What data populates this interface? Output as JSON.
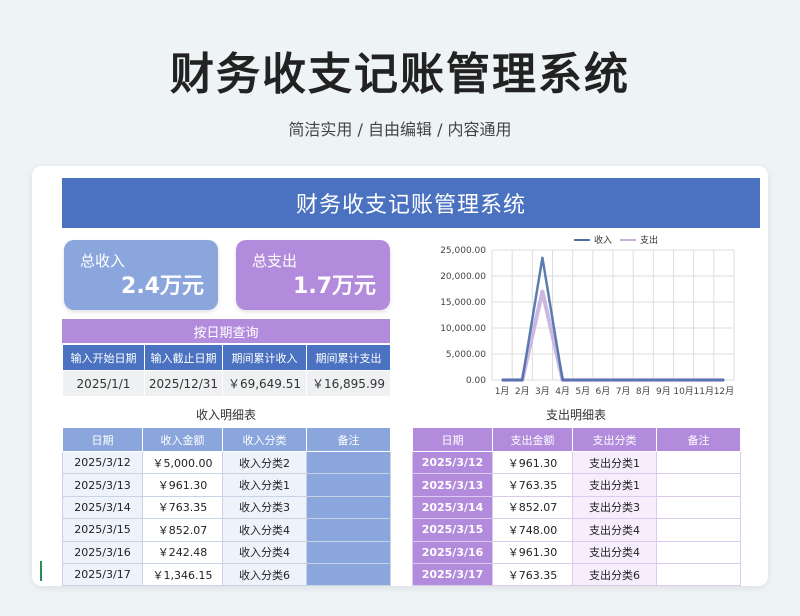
{
  "hero": {
    "title": "财务收支记账管理系统",
    "subtitle": "简洁实用 / 自由编辑 / 内容通用"
  },
  "banner": {
    "title": "财务收支记账管理系统"
  },
  "stats": {
    "income": {
      "label": "总收入",
      "value": "2.4万元"
    },
    "expense": {
      "label": "总支出",
      "value": "1.7万元"
    }
  },
  "query": {
    "title": "按日期查询",
    "headers": [
      "输入开始日期",
      "输入截止日期",
      "期间累计收入",
      "期间累计支出"
    ],
    "values": [
      "2025/1/1",
      "2025/12/31",
      "￥69,649.51",
      "￥16,895.99"
    ]
  },
  "income_table": {
    "title": "收入明细表",
    "headers": [
      "日期",
      "收入金额",
      "收入分类",
      "备注"
    ],
    "rows": [
      [
        "2025/3/12",
        "￥5,000.00",
        "收入分类2",
        ""
      ],
      [
        "2025/3/13",
        "￥961.30",
        "收入分类1",
        ""
      ],
      [
        "2025/3/14",
        "￥763.35",
        "收入分类3",
        ""
      ],
      [
        "2025/3/15",
        "￥852.07",
        "收入分类4",
        ""
      ],
      [
        "2025/3/16",
        "￥242.48",
        "收入分类4",
        ""
      ],
      [
        "2025/3/17",
        "￥1,346.15",
        "收入分类6",
        ""
      ]
    ]
  },
  "expense_table": {
    "title": "支出明细表",
    "headers": [
      "日期",
      "支出金额",
      "支出分类",
      "备注"
    ],
    "rows": [
      [
        "2025/3/12",
        "￥961.30",
        "支出分类1",
        ""
      ],
      [
        "2025/3/13",
        "￥763.35",
        "支出分类1",
        ""
      ],
      [
        "2025/3/14",
        "￥852.07",
        "支出分类3",
        ""
      ],
      [
        "2025/3/15",
        "￥748.00",
        "支出分类4",
        ""
      ],
      [
        "2025/3/16",
        "￥961.30",
        "支出分类4",
        ""
      ],
      [
        "2025/3/17",
        "￥763.35",
        "支出分类6",
        ""
      ]
    ]
  },
  "chart_data": {
    "type": "line",
    "categories": [
      "1月",
      "2月",
      "3月",
      "4月",
      "5月",
      "6月",
      "7月",
      "8月",
      "9月",
      "10月",
      "11月",
      "12月"
    ],
    "series": [
      {
        "name": "收入",
        "color": "#4a6fa8",
        "values": [
          0,
          0,
          23500,
          0,
          0,
          0,
          0,
          0,
          0,
          0,
          0,
          0
        ]
      },
      {
        "name": "支出",
        "color": "#c8b0e0",
        "values": [
          0,
          0,
          17000,
          0,
          0,
          0,
          0,
          0,
          0,
          0,
          0,
          0
        ]
      }
    ],
    "ylim": [
      0,
      25000
    ],
    "yticks": [
      "0.00",
      "5,000.00",
      "10,000.00",
      "15,000.00",
      "20,000.00",
      "25,000.00"
    ],
    "grid": true,
    "legend": "top"
  }
}
